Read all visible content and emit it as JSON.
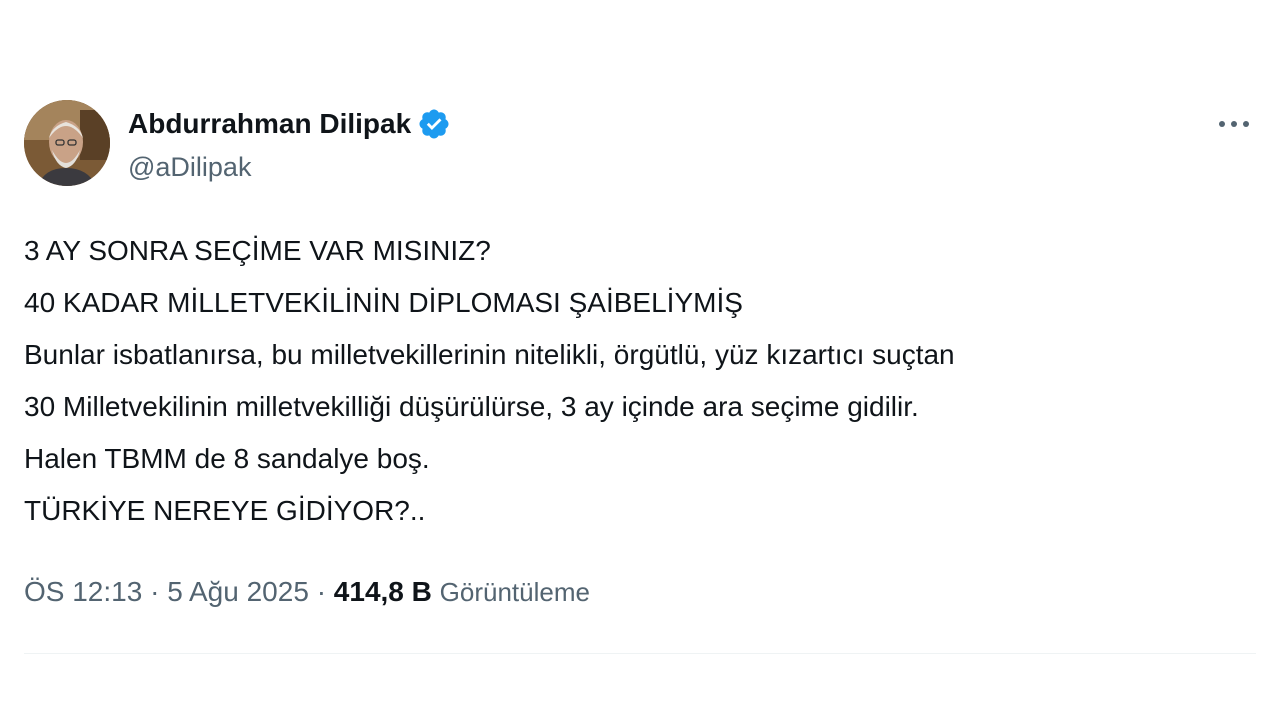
{
  "author": {
    "display_name": "Abdurrahman Dilipak",
    "handle": "@aDilipak",
    "verified": true
  },
  "tweet": {
    "lines": [
      "3 AY SONRA SEÇİME VAR MISINIZ?",
      "40 KADAR MİLLETVEKİLİNİN DİPLOMASI ŞAİBELİYMİŞ",
      "Bunlar isbatlanırsa, bu milletvekillerinin nitelikli, örgütlü, yüz kızartıcı suçtan",
      "30 Milletvekilinin milletvekilliği düşürülürse,  3 ay içinde  ara seçime gidilir.",
      "Halen TBMM de 8 sandalye boş.",
      "TÜRKİYE NEREYE GİDİYOR?.."
    ],
    "time": "ÖS 12:13",
    "separator": "·",
    "date": "5 Ağu 2025",
    "views_count": "414,8 B",
    "views_label": "Görüntüleme"
  },
  "icons": {
    "verified": "verified-badge-icon",
    "more": "more-horizontal-icon"
  },
  "colors": {
    "verified_blue": "#1d9bf0",
    "secondary_text": "#536471",
    "primary_text": "#0f1419"
  }
}
